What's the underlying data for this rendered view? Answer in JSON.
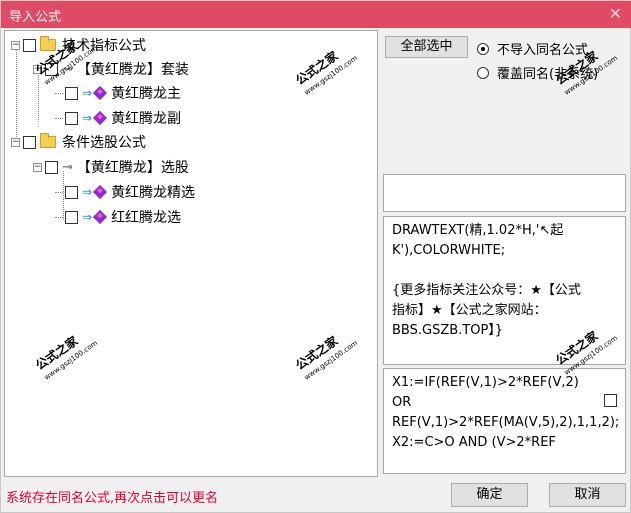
{
  "window": {
    "title": "导入公式",
    "close_glyph": "✕"
  },
  "tree": {
    "n1": {
      "label": "技术指标公式"
    },
    "n2": {
      "label": "【黄红腾龙】套装"
    },
    "n3": {
      "label": "黄红腾龙主"
    },
    "n4": {
      "label": "黄红腾龙副"
    },
    "n5": {
      "label": "条件选股公式"
    },
    "n6": {
      "label": "【黄红腾龙】选股"
    },
    "n7": {
      "label": "黄红腾龙精选"
    },
    "n8": {
      "label": "红红腾龙选"
    }
  },
  "controls": {
    "select_all": "全部选中",
    "radio1": "不导入同名公式",
    "radio2": "覆盖同名(非系统)",
    "radio_selected": "radio1"
  },
  "description": "DRAWTEXT(精,1.02*H,'↖起K'),COLORWHITE;\n\n{更多指标关注公众号：★【公式指标】★【公式之家网站：BBS.GSZB.TOP】}",
  "code_text": "X1:=IF(REF(V,1)>2*REF(V,2) OR REF(V,1)>2*REF(MA(V,5),2),1,1,2);\nX2:=C>O AND (V>2*REF",
  "status": "系统存在同名公式,再次点击可以更名",
  "buttons": {
    "ok": "确定",
    "cancel": "取消"
  },
  "watermark": {
    "cn": "公式之家",
    "url": "www.gszj100.com"
  }
}
